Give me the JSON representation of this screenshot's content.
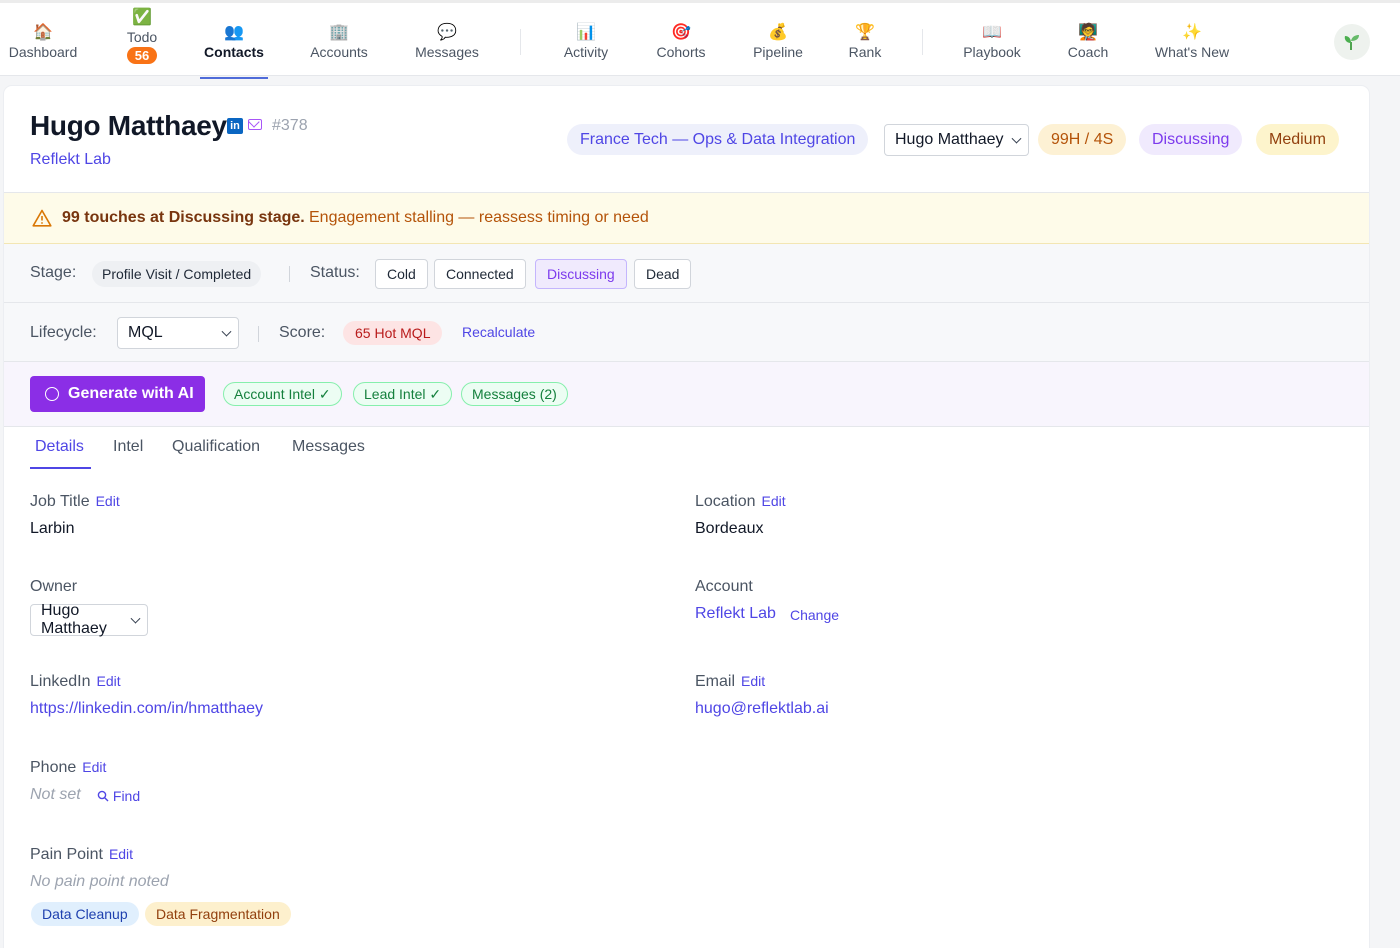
{
  "nav": {
    "items": [
      {
        "label": "Dashboard",
        "icon": "🏠"
      },
      {
        "label": "Todo",
        "icon": "✅",
        "badge": "56"
      },
      {
        "label": "Contacts",
        "icon": "👥"
      },
      {
        "label": "Accounts",
        "icon": "🏢"
      },
      {
        "label": "Messages",
        "icon": "💬"
      },
      {
        "label": "Activity",
        "icon": "📊"
      },
      {
        "label": "Cohorts",
        "icon": "🎯"
      },
      {
        "label": "Pipeline",
        "icon": "💰"
      },
      {
        "label": "Rank",
        "icon": "🏆"
      },
      {
        "label": "Playbook",
        "icon": "📖"
      },
      {
        "label": "Coach",
        "icon": "🧑‍🏫"
      },
      {
        "label": "What's New",
        "icon": "✨"
      }
    ],
    "active": "Contacts"
  },
  "contact": {
    "name": "Hugo Matthaey",
    "id": "#378",
    "company": "Reflekt Lab",
    "campaign": "France Tech — Ops & Data Integration",
    "owner": "Hugo Matthaey",
    "touches_badge": "99H / 4S",
    "status_badge": "Discussing",
    "priority_badge": "Medium"
  },
  "alert": {
    "strong": "99 touches at Discussing stage.",
    "message": "Engagement stalling — reassess timing or need"
  },
  "stage_row": {
    "stage_label": "Stage:",
    "stage_value": "Profile Visit / Completed",
    "status_label": "Status:",
    "statuses": [
      "Cold",
      "Connected",
      "Discussing",
      "Dead"
    ],
    "selected_status": "Discussing"
  },
  "lifecycle_row": {
    "lifecycle_label": "Lifecycle:",
    "lifecycle_value": "MQL",
    "score_label": "Score:",
    "score_value": "65 Hot MQL",
    "recalculate": "Recalculate"
  },
  "ai_row": {
    "generate": "Generate with AI",
    "chips": [
      "Account Intel ✓",
      "Lead Intel ✓",
      "Messages (2)"
    ]
  },
  "tabs": [
    "Details",
    "Intel",
    "Qualification",
    "Messages"
  ],
  "active_tab": "Details",
  "details": {
    "edit": "Edit",
    "job_title_label": "Job Title",
    "job_title": "Larbin",
    "location_label": "Location",
    "location": "Bordeaux",
    "owner_label": "Owner",
    "owner": "Hugo Matthaey",
    "account_label": "Account",
    "account": "Reflekt Lab",
    "change": "Change",
    "linkedin_label": "LinkedIn",
    "linkedin": "https://linkedin.com/in/hmatthaey",
    "email_label": "Email",
    "email": "hugo@reflektlab.ai",
    "phone_label": "Phone",
    "phone": "Not set",
    "find": "Find",
    "pain_label": "Pain Point",
    "pain": "No pain point noted",
    "pain_tags": [
      "Data Cleanup",
      "Data Fragmentation"
    ]
  }
}
